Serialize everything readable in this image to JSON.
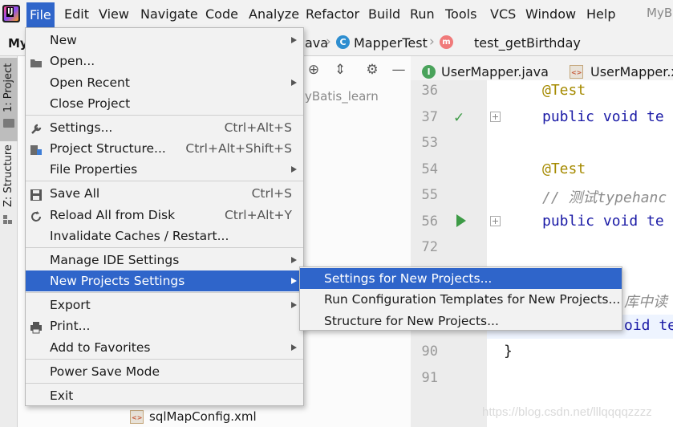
{
  "menubar": {
    "items": [
      {
        "label": "File",
        "active": true
      },
      {
        "label": "Edit"
      },
      {
        "label": "View"
      },
      {
        "label": "Navigate"
      },
      {
        "label": "Code"
      },
      {
        "label": "Analyze"
      },
      {
        "label": "Refactor"
      },
      {
        "label": "Build"
      },
      {
        "label": "Run"
      },
      {
        "label": "Tools"
      },
      {
        "label": "VCS"
      },
      {
        "label": "Window"
      },
      {
        "label": "Help"
      }
    ],
    "project_short": "MyBa"
  },
  "navbar": {
    "project_label": "My",
    "crumb_java": "ava",
    "crumb_class": "MapperTest",
    "crumb_method": "test_getBirthday"
  },
  "toolstrip": {
    "project_tab": "1: Project",
    "structure_tab": "Z: Structure"
  },
  "project_panel": {
    "subtext": "yBatis_learn",
    "file_name": "sqlMapConfig.xml"
  },
  "tabs": [
    {
      "label": "UserMapper.java",
      "icon": "interface-icon"
    },
    {
      "label": "UserMapper.x",
      "icon": "xml-icon"
    }
  ],
  "editor": {
    "lines": [
      {
        "num": "36",
        "code": "@Test"
      },
      {
        "num": "37",
        "code": "public void te"
      },
      {
        "num": "53",
        "code": ""
      },
      {
        "num": "54",
        "code": "@Test"
      },
      {
        "num": "55",
        "code": "// 测试typehanc"
      },
      {
        "num": "56",
        "code": "public void te"
      },
      {
        "num": "72",
        "code": ""
      },
      {
        "num": "90",
        "code": "}"
      },
      {
        "num": "91",
        "code": ""
      }
    ],
    "partial_comment": "库中读",
    "partial_code": "oid te"
  },
  "file_menu": {
    "items": [
      {
        "label": "New",
        "submenu": true
      },
      {
        "label": "Open..."
      },
      {
        "label": "Open Recent",
        "submenu": true
      },
      {
        "label": "Close Project"
      },
      {
        "label": "Settings...",
        "shortcut": "Ctrl+Alt+S"
      },
      {
        "label": "Project Structure...",
        "shortcut": "Ctrl+Alt+Shift+S"
      },
      {
        "label": "File Properties",
        "submenu": true
      },
      {
        "label": "Save All",
        "shortcut": "Ctrl+S"
      },
      {
        "label": "Reload All from Disk",
        "shortcut": "Ctrl+Alt+Y"
      },
      {
        "label": "Invalidate Caches / Restart..."
      },
      {
        "label": "Manage IDE Settings",
        "submenu": true
      },
      {
        "label": "New Projects Settings",
        "submenu": true,
        "selected": true
      },
      {
        "label": "Export",
        "submenu": true
      },
      {
        "label": "Print..."
      },
      {
        "label": "Add to Favorites",
        "submenu": true
      },
      {
        "label": "Power Save Mode"
      },
      {
        "label": "Exit"
      }
    ]
  },
  "submenu": {
    "items": [
      {
        "label": "Settings for New Projects...",
        "selected": true
      },
      {
        "label": "Run Configuration Templates for New Projects..."
      },
      {
        "label": "Structure for New Projects..."
      }
    ]
  },
  "watermark": "https://blog.csdn.net/lllqqqqzzzz",
  "colors": {
    "accent": "#2f65ca",
    "annotation": "#a58a00",
    "keyword": "#1a1aa6",
    "run_green": "#3d9b46"
  }
}
